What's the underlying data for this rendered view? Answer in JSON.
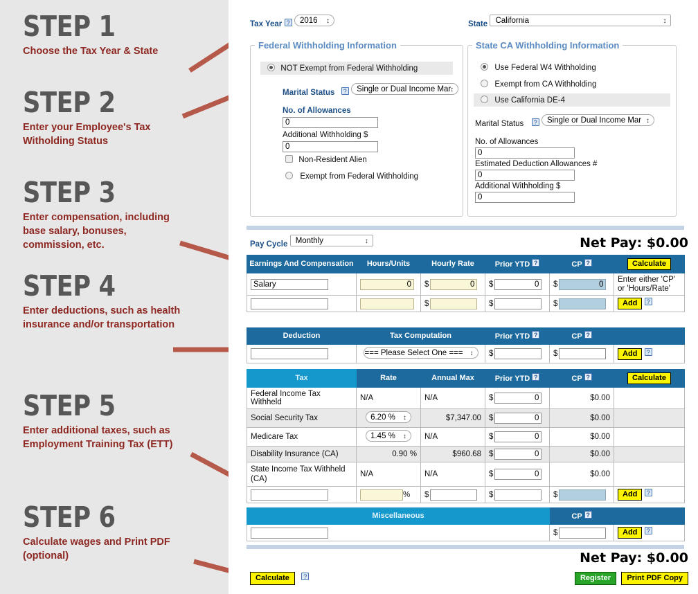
{
  "steps": [
    {
      "title": "STEP 1",
      "desc": "Choose the Tax Year & State"
    },
    {
      "title": "STEP 2",
      "desc": "Enter your Employee's Tax Witholding Status"
    },
    {
      "title": "STEP 3",
      "desc": "Enter compensation, including base salary, bonuses, commission, etc."
    },
    {
      "title": "STEP 4",
      "desc": "Enter deductions, such as health insurance and/or transportation"
    },
    {
      "title": "STEP 5",
      "desc": "Enter additional taxes, such as Employment Training Tax (ETT)"
    },
    {
      "title": "STEP 6",
      "desc": "Calculate wages and Print PDF (optional)"
    }
  ],
  "colors": {
    "step_title": "#575757",
    "step_desc": "#8e2822",
    "arrow": "#b5594a",
    "header_blue": "#1d6a9e",
    "header_cyan": "#1598cc",
    "legend_blue": "#5b8bc0",
    "button_yellow": "#fdf500",
    "button_green": "#28a428",
    "input_yellow": "#faf7d8",
    "input_blue": "#b2cfdf",
    "panel_bg": "#e7e7e7"
  },
  "top": {
    "tax_year_label": "Tax Year",
    "tax_year_value": "2016",
    "state_label": "State",
    "state_value": "California",
    "help_glyph": "?"
  },
  "federal": {
    "legend": "Federal Withholding Information",
    "not_exempt_label": "NOT Exempt from Federal Withholding",
    "marital_label": "Marital Status",
    "marital_value": "Single or Dual Income Mar",
    "allowances_label": "No. of Allowances",
    "allowances_value": "0",
    "additional_label": "Additional Withholding $",
    "additional_value": "0",
    "nra_label": "Non-Resident Alien",
    "exempt_label": "Exempt from Federal Withholding"
  },
  "state_wh": {
    "legend": "State CA Withholding Information",
    "opt_federal_w4": "Use Federal W4 Withholding",
    "opt_exempt_ca": "Exempt from CA Withholding",
    "opt_de4": "Use California DE-4",
    "marital_label": "Marital Status",
    "marital_value": "Single or Dual Income Mar",
    "allowances_label": "No. of Allowances",
    "allowances_value": "0",
    "estimated_label": "Estimated Deduction Allowances #",
    "estimated_value": "0",
    "additional_label": "Additional Withholding $",
    "additional_value": "0"
  },
  "pay": {
    "pay_cycle_label": "Pay Cycle",
    "pay_cycle_value": "Monthly",
    "net_pay_top": "Net Pay: $0.00",
    "net_pay_bottom": "Net Pay: $0.00"
  },
  "earnings_table": {
    "headers": [
      "Earnings And Compensation",
      "Hours/Units",
      "Hourly Rate",
      "Prior YTD",
      "CP",
      "Calculate"
    ],
    "rows": [
      {
        "name": "Salary",
        "hours": "0",
        "rate": "0",
        "ytd": "0",
        "cp": "0",
        "action": "Enter either 'CP' or 'Hours/Rate'"
      },
      {
        "name": "",
        "hours": "",
        "rate": "",
        "ytd": "",
        "cp": "",
        "action": "Add"
      }
    ],
    "currency": "$"
  },
  "deduction_table": {
    "headers": [
      "Deduction",
      "Tax Computation",
      "Prior YTD",
      "CP",
      ""
    ],
    "row": {
      "name": "",
      "computation": "=== Please Select One ===",
      "ytd": "",
      "cp": "",
      "action": "Add"
    },
    "currency": "$"
  },
  "tax_table": {
    "headers": [
      "Tax",
      "Rate",
      "Annual Max",
      "Prior YTD",
      "CP",
      "Calculate"
    ],
    "rows": [
      {
        "tax": "Federal Income Tax Withheld",
        "rate": "N/A",
        "rate_is_select": false,
        "max": "N/A",
        "ytd": "0",
        "cp": "$0.00"
      },
      {
        "tax": "Social Security Tax",
        "rate": "6.20 %",
        "rate_is_select": true,
        "max": "$7,347.00",
        "ytd": "0",
        "cp": "$0.00"
      },
      {
        "tax": "Medicare Tax",
        "rate": "1.45 %",
        "rate_is_select": true,
        "max": "N/A",
        "ytd": "0",
        "cp": "$0.00"
      },
      {
        "tax": "Disability Insurance (CA)",
        "rate": "0.90 %",
        "rate_is_select": false,
        "max": "$960.68",
        "ytd": "0",
        "cp": "$0.00"
      },
      {
        "tax": "State Income Tax Withheld (CA)",
        "rate": "N/A",
        "rate_is_select": false,
        "max": "N/A",
        "ytd": "0",
        "cp": "$0.00"
      }
    ],
    "blank_row": {
      "tax": "",
      "rate": "",
      "percent": "%",
      "max": "",
      "ytd": "",
      "cp": "",
      "action": "Add"
    },
    "currency": "$"
  },
  "misc_table": {
    "headers": [
      "Miscellaneous",
      "CP",
      ""
    ],
    "row": {
      "name": "",
      "cp": "",
      "action": "Add"
    },
    "currency": "$"
  },
  "footer": {
    "calculate_label": "Calculate",
    "register_label": "Register",
    "print_label": "Print PDF Copy"
  }
}
